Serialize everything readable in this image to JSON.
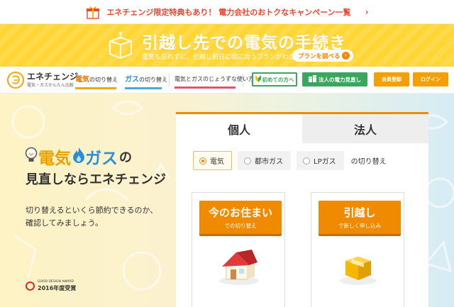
{
  "promo": {
    "text": "エネチェンジ限定特典もあり！ 電力会社のおトクなキャンペーン一覧",
    "arrow": "›"
  },
  "banner": {
    "title": "引越し先での電気の手続き",
    "subtitle": "電気も忘れずに。引越し前日に間に合うプランがわかる。",
    "button": "プランを調べる",
    "button_arrow": "›"
  },
  "nav": {
    "logo_name": "エネチェンジ",
    "logo_tagline": "電気・ガスかんたん比較",
    "link_electric_main": "電気",
    "link_electric_rest": "の切り替え",
    "link_gas_main": "ガス",
    "link_gas_rest": "の切り替え",
    "link_usage": "電気とガスのじょうずな使い方",
    "btn_first": "初めての方へ",
    "btn_corp": "法人の電力見直し",
    "btn_register": "会員登録",
    "btn_login": "ログイン"
  },
  "hero": {
    "headline_electric": "電気",
    "headline_gas": "ガス",
    "headline_no": "の",
    "headline_line2": "見直しならエネチェンジ",
    "body_line1": "切り替えるといくら節約できるのか、",
    "body_line2": "確認してみましょう。",
    "award_small": "GOOD DESIGN AWARD",
    "award_big": "2016年度受賞"
  },
  "panel": {
    "tabs": [
      {
        "label": "個人",
        "active": true
      },
      {
        "label": "法人",
        "active": false
      }
    ],
    "radios": [
      {
        "label": "電気",
        "selected": true
      },
      {
        "label": "都市ガス",
        "selected": false
      },
      {
        "label": "LPガス",
        "selected": false
      }
    ],
    "switch_label": "の切り替え",
    "cards": [
      {
        "main": "今のお住まい",
        "sub": "での切り替え",
        "icon": "house-icon"
      },
      {
        "main": "引越し",
        "sub": "で新しく申し込み",
        "icon": "moving-box-icon"
      }
    ]
  },
  "colors": {
    "accent_orange": "#f08a00",
    "banner_yellow": "#ffd633",
    "green": "#39a85e",
    "promo_red": "#e8472f"
  }
}
